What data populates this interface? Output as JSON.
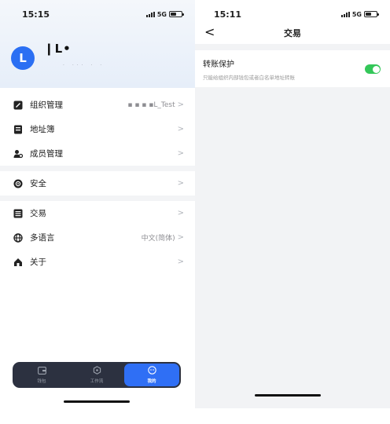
{
  "left": {
    "status": {
      "time": "15:15",
      "network": "5G"
    },
    "profile": {
      "avatar_letter": "L",
      "name": "❙L•",
      "id_masked": "· ··· · ·"
    },
    "menu": [
      {
        "icon": "organization-icon",
        "label": "组织管理",
        "value": "▪ ▪ ▪ ▪L_Test"
      },
      {
        "icon": "address-book-icon",
        "label": "地址簿",
        "value": ""
      },
      {
        "icon": "members-icon",
        "label": "成员管理",
        "value": ""
      },
      {
        "icon": "security-icon",
        "label": "安全",
        "value": ""
      },
      {
        "icon": "transaction-icon",
        "label": "交易",
        "value": ""
      },
      {
        "icon": "language-icon",
        "label": "多语言",
        "value": "中文(简体)"
      },
      {
        "icon": "about-icon",
        "label": "关于",
        "value": ""
      }
    ],
    "tabbar": [
      {
        "icon": "wallet-icon",
        "label": "钱包"
      },
      {
        "icon": "workflow-icon",
        "label": "工作流"
      },
      {
        "icon": "profile-icon",
        "label": "我的"
      }
    ]
  },
  "right": {
    "status": {
      "time": "15:11",
      "network": "5G"
    },
    "header": {
      "title": "交易",
      "back": "<"
    },
    "setting": {
      "title": "转账保护",
      "description": "只能给组织内部钱包或者白名单地址转账",
      "enabled": true
    }
  },
  "colors": {
    "accent": "#2f6ff5",
    "toggle_on": "#34c759",
    "tabbar_bg": "#2c3140"
  }
}
